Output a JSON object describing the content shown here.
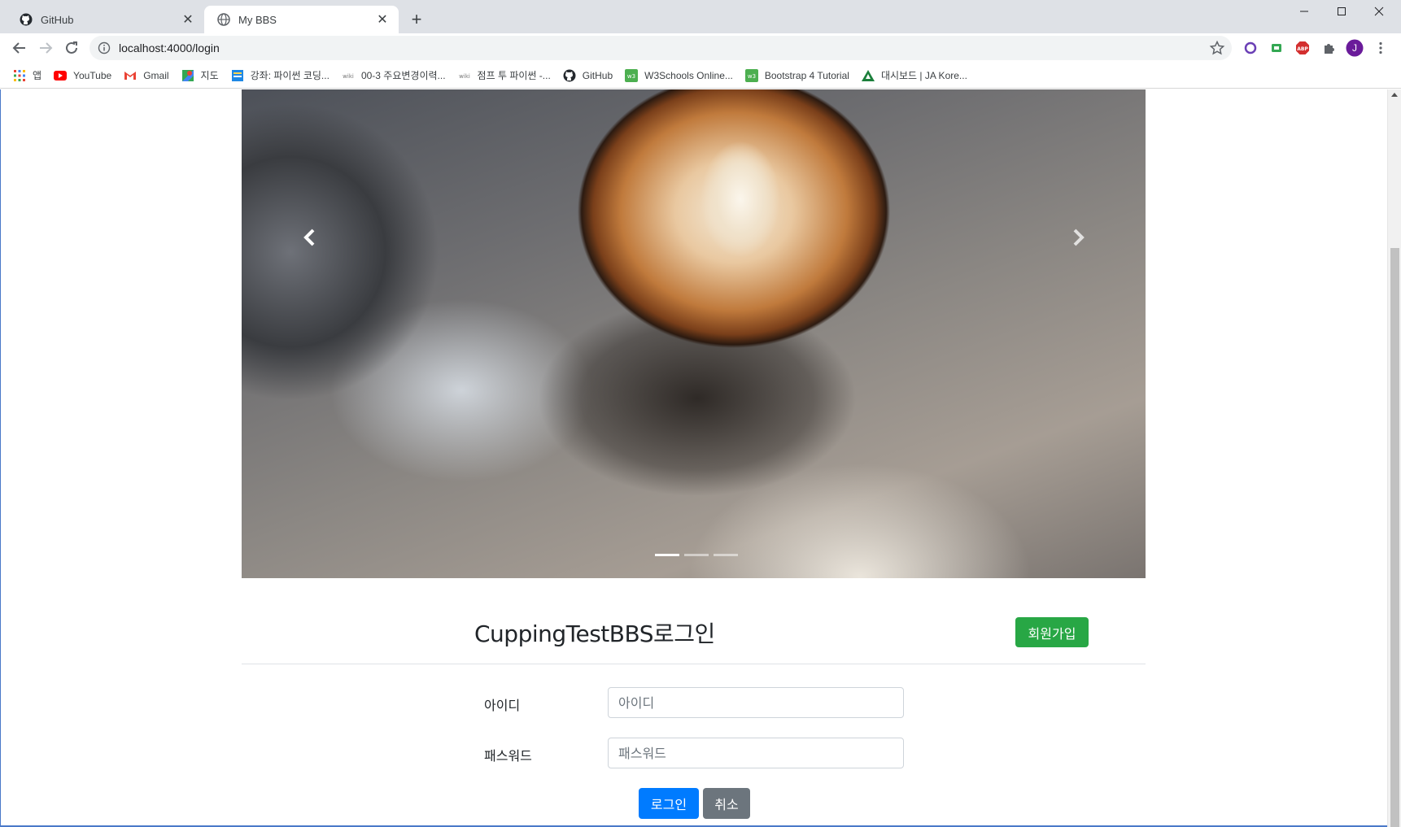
{
  "browser": {
    "tabs": [
      {
        "title": "GitHub",
        "active": false,
        "icon": "github-icon"
      },
      {
        "title": "My BBS",
        "active": true,
        "icon": "globe-icon"
      }
    ],
    "url": "localhost:4000/login",
    "bookmarks": [
      {
        "label": "앱",
        "icon": "apps-grid-icon"
      },
      {
        "label": "YouTube",
        "icon": "youtube-icon"
      },
      {
        "label": "Gmail",
        "icon": "gmail-icon"
      },
      {
        "label": "지도",
        "icon": "maps-icon"
      },
      {
        "label": "강좌: 파이썬 코딩...",
        "icon": "course-icon"
      },
      {
        "label": "00-3 주요변경이력...",
        "icon": "wiki-icon"
      },
      {
        "label": "점프 투 파이썬 -...",
        "icon": "wiki-icon"
      },
      {
        "label": "GitHub",
        "icon": "github-icon"
      },
      {
        "label": "W3Schools Online...",
        "icon": "w3schools-icon"
      },
      {
        "label": "Bootstrap 4 Tutorial",
        "icon": "w3schools-icon"
      },
      {
        "label": "대시보드 | JA Kore...",
        "icon": "ja-triangle-icon"
      }
    ],
    "profile_initial": "J",
    "colors": {
      "tabstrip": "#dee1e6",
      "profile": "#6a1b9a",
      "abp": "#d32f2f"
    }
  },
  "carousel": {
    "slide_count": 3,
    "active_index": 0,
    "image_description_icon": "latte-art-photo"
  },
  "login": {
    "title": "CuppingTestBBS로그인",
    "signup_label": "회원가입",
    "id_label": "아이디",
    "id_placeholder": "아이디",
    "password_label": "패스워드",
    "password_placeholder": "패스워드",
    "submit_label": "로그인",
    "cancel_label": "취소",
    "colors": {
      "signup": "#28a745",
      "submit": "#007bff",
      "cancel": "#6c757d"
    }
  }
}
